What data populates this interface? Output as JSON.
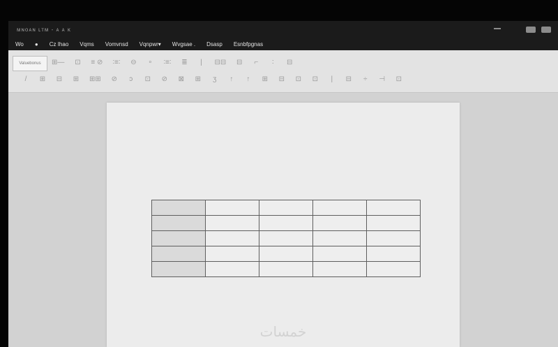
{
  "window": {
    "title": "ᴍɴᴏᴀɴ ʟᴛᴍ - ᴀ ᴀ ᴋ"
  },
  "menu": {
    "items": [
      "Wo",
      "●",
      "Cz Ihao",
      "Vqms",
      "Vomvnsd",
      "Vqnpwr▾",
      "Wvgsae .",
      "Dsasp",
      "Esnbfpgnas"
    ]
  },
  "ribbon": {
    "style_box_label": "Valuebonus",
    "row1": [
      "⊞—",
      "⊡",
      "≡ ⊘",
      "∶≡∶",
      "⊖",
      "∘",
      "∶≡∶",
      "≣",
      "|",
      "⊟⊟",
      "⊟",
      "⌐",
      "∶",
      "⊟"
    ],
    "row2": [
      "/",
      "⊞",
      "⊟",
      "⊞",
      "⊞⊞",
      "⊘",
      "ɔ",
      "⊡",
      "⊘",
      "⊠",
      "⊞",
      "ʒ",
      "↑",
      "↑",
      "⊞",
      "⊟",
      "⊡",
      "⊡",
      "|",
      "⊟",
      "÷",
      "⊣",
      "⊡"
    ]
  },
  "document": {
    "watermark": "خمسات",
    "table": {
      "rows": 5,
      "cols": 5
    }
  }
}
